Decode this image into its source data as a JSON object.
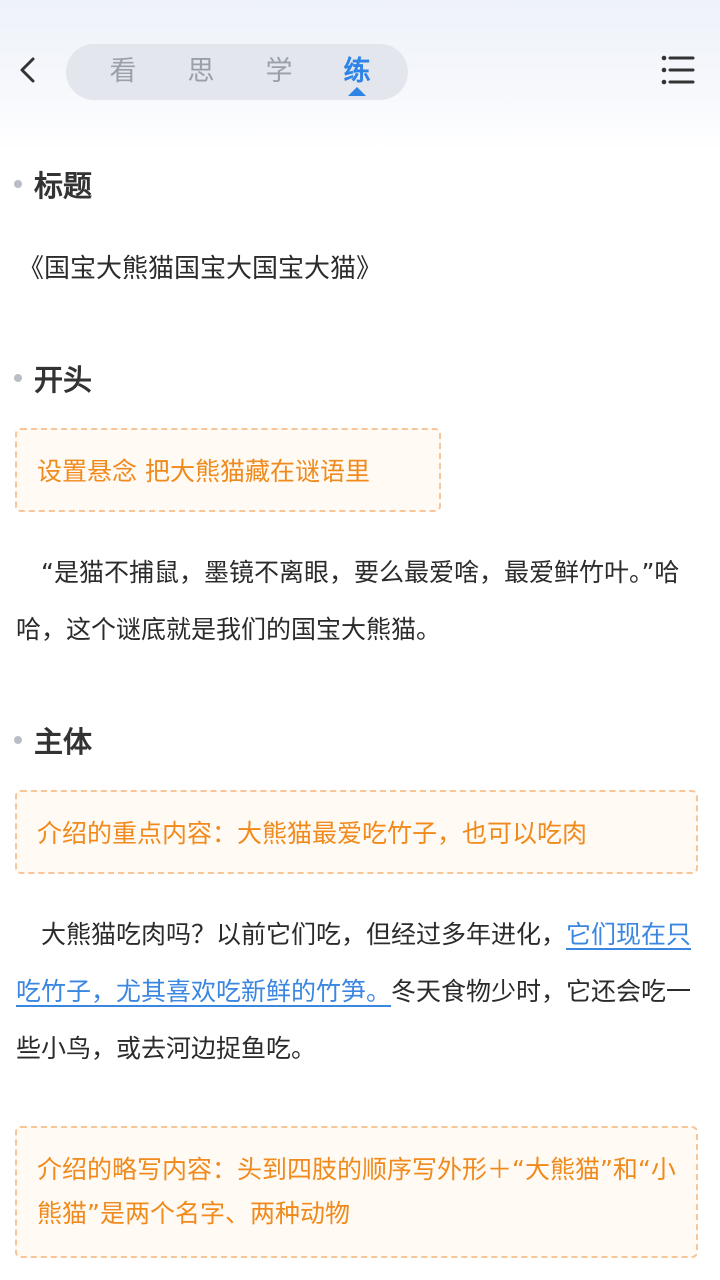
{
  "header": {
    "tabs": [
      {
        "label": "看"
      },
      {
        "label": "思"
      },
      {
        "label": "学"
      },
      {
        "label": "练"
      }
    ],
    "active_tab": "练"
  },
  "sections": {
    "title": {
      "heading": "标题",
      "text": "《国宝大熊猫国宝大国宝大猫》"
    },
    "opening": {
      "heading": "开头",
      "tag": "设置悬念 把大熊猫藏在谜语里",
      "para": "“是猫不捕鼠，墨镜不离眼，要么最爱啥，最爱鲜竹叶。”哈哈，这个谜底就是我们的国宝大熊猫。"
    },
    "body": {
      "heading": "主体",
      "tag": "介绍的重点内容：大熊猫最爱吃竹子，也可以吃肉",
      "para_before": "大熊猫吃肉吗？以前它们吃，但经过多年进化，",
      "para_link": "它们现在只吃竹子，尤其喜欢吃新鲜的竹笋。",
      "para_after": "冬天食物少时，它还会吃一些小鸟，或去河边捉鱼吃。",
      "tag2": "介绍的略写内容：头到四肢的顺序写外形＋“大熊猫”和“小熊猫”是两个名字、两种动物"
    }
  },
  "colors": {
    "accent": "#2e83e6",
    "tag_text": "#f08a1c",
    "tag_border": "#f6c59a",
    "link": "#3a86e0"
  }
}
